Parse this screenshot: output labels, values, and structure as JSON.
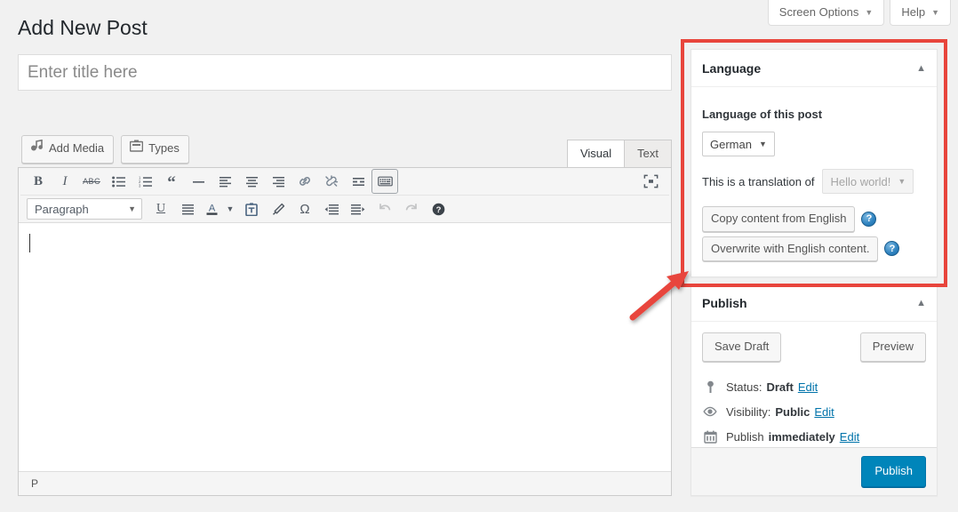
{
  "screen_meta": {
    "buttons": [
      {
        "label": "Screen Options",
        "caret": "▼"
      },
      {
        "label": "Help",
        "caret": "▼"
      }
    ]
  },
  "page": {
    "title": "Add New Post"
  },
  "title_field": {
    "value": "",
    "placeholder": "Enter title here"
  },
  "media_buttons": [
    {
      "label": "Add Media",
      "icon": "media-icon"
    },
    {
      "label": "Types",
      "icon": "folder-icon"
    }
  ],
  "editor_tabs": [
    {
      "label": "Visual",
      "active": true
    },
    {
      "label": "Text",
      "active": false
    }
  ],
  "toolbar": {
    "row1": [
      {
        "name": "bold-icon",
        "glyph": "B"
      },
      {
        "name": "italic-icon",
        "glyph": "I"
      },
      {
        "name": "strikethrough-icon",
        "glyph": "ABC"
      },
      {
        "name": "bulleted-list-icon",
        "glyph": ""
      },
      {
        "name": "numbered-list-icon",
        "glyph": ""
      },
      {
        "name": "blockquote-icon",
        "glyph": "“"
      },
      {
        "name": "horizontal-rule-icon",
        "glyph": "—"
      },
      {
        "name": "align-left-icon",
        "glyph": ""
      },
      {
        "name": "align-center-icon",
        "glyph": ""
      },
      {
        "name": "align-right-icon",
        "glyph": ""
      },
      {
        "name": "insert-link-icon",
        "glyph": ""
      },
      {
        "name": "unlink-icon",
        "glyph": ""
      },
      {
        "name": "read-more-icon",
        "glyph": ""
      },
      {
        "name": "keyboard-shortcuts-icon",
        "glyph": ""
      },
      {
        "name": "distraction-free-icon",
        "glyph": ""
      }
    ],
    "paragraph_select": {
      "value": "Paragraph",
      "caret": "▼"
    },
    "row2": [
      {
        "name": "underline-icon",
        "glyph": "U"
      },
      {
        "name": "justify-icon",
        "glyph": ""
      },
      {
        "name": "text-color-icon",
        "glyph": "A"
      },
      {
        "name": "text-color-caret-icon",
        "glyph": "▼"
      },
      {
        "name": "paste-as-text-icon",
        "glyph": ""
      },
      {
        "name": "clear-formatting-icon",
        "glyph": ""
      },
      {
        "name": "special-character-icon",
        "glyph": "Ω"
      },
      {
        "name": "outdent-icon",
        "glyph": ""
      },
      {
        "name": "indent-icon",
        "glyph": ""
      },
      {
        "name": "undo-icon",
        "glyph": ""
      },
      {
        "name": "redo-icon",
        "glyph": ""
      },
      {
        "name": "editor-help-icon",
        "glyph": "?"
      }
    ]
  },
  "editor": {
    "content": "",
    "status_path": "P"
  },
  "language_panel": {
    "title": "Language",
    "toggle_caret": "▲",
    "field_label": "Language of this post",
    "language_select": {
      "value": "German",
      "caret": "▼"
    },
    "translation_label": "This is a translation of",
    "translation_select": {
      "value": "Hello world!",
      "caret": "▼",
      "disabled": true
    },
    "copy_buttons": [
      {
        "label": "Copy content from English",
        "help": "?"
      },
      {
        "label": "Overwrite with English content.",
        "help": "?"
      }
    ]
  },
  "publish_panel": {
    "title": "Publish",
    "toggle_caret": "▲",
    "save_draft_label": "Save Draft",
    "preview_label": "Preview",
    "rows": [
      {
        "icon": "pin-icon",
        "prefix": "Status:",
        "value": "Draft",
        "suffix": "",
        "edit": "Edit"
      },
      {
        "icon": "eye-icon",
        "prefix": "Visibility:",
        "value": "Public",
        "suffix": "",
        "edit": "Edit"
      },
      {
        "icon": "calendar-icon",
        "prefix": "Publish",
        "value": "immediately",
        "suffix": "",
        "edit": "Edit"
      }
    ],
    "publish_label": "Publish"
  },
  "annotations": {
    "highlight_color": "#e8453c",
    "arrow_color": "#e8453c"
  },
  "colors": {
    "accent": "#0085ba",
    "link": "#0073aa",
    "background": "#f1f1f1",
    "panel_border": "#e5e5e5"
  }
}
